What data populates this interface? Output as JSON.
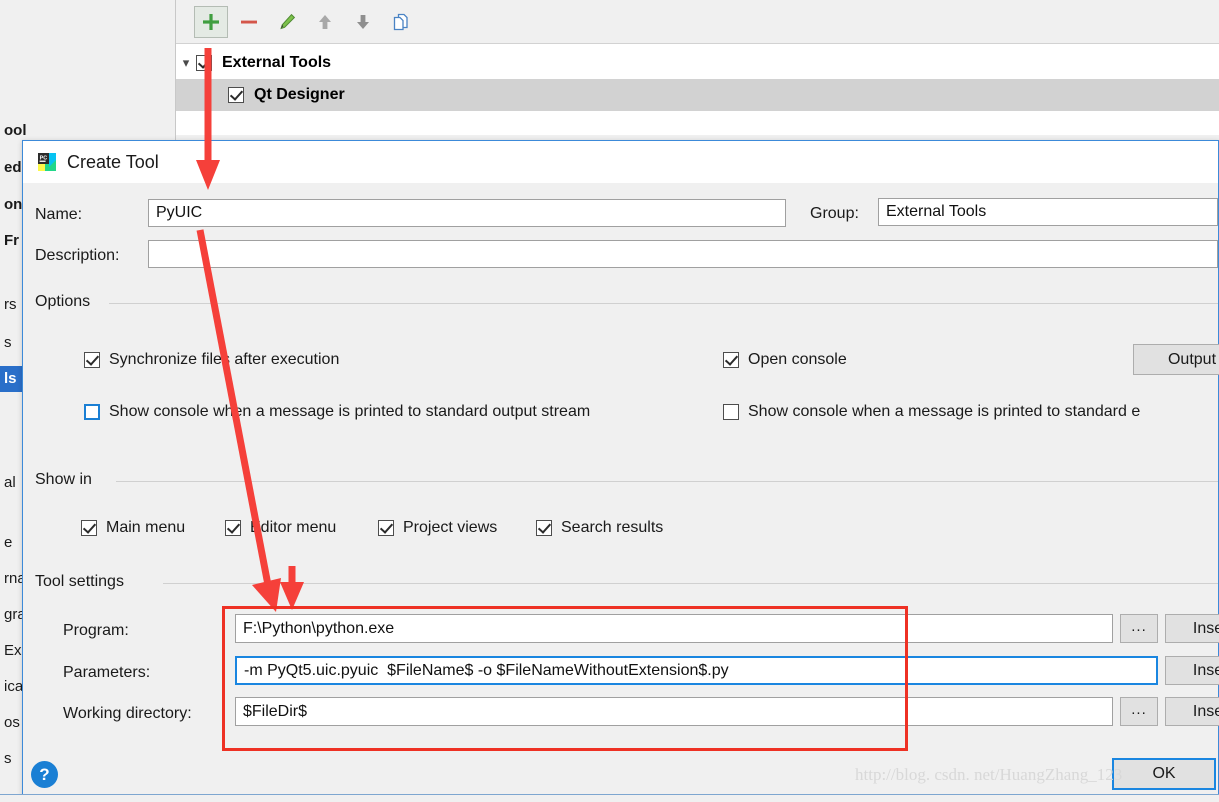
{
  "background_window": {
    "sidebar_items": [
      {
        "label": "ool",
        "bold": true,
        "selected": false
      },
      {
        "label": "ed",
        "bold": true,
        "selected": false
      },
      {
        "label": "on",
        "bold": true,
        "selected": false
      },
      {
        "label": "Fr",
        "bold": true,
        "selected": false
      },
      {
        "label": "rs",
        "bold": false,
        "selected": false
      },
      {
        "label": "s",
        "bold": false,
        "selected": false
      },
      {
        "label": "ls",
        "bold": true,
        "selected": true
      },
      {
        "label": "al",
        "bold": false,
        "selected": false
      },
      {
        "label": "e",
        "bold": false,
        "selected": false
      },
      {
        "label": "rna",
        "bold": false,
        "selected": false
      },
      {
        "label": "gra",
        "bold": false,
        "selected": false
      },
      {
        "label": "Ex",
        "bold": false,
        "selected": false
      },
      {
        "label": "ica",
        "bold": false,
        "selected": false
      },
      {
        "label": "os",
        "bold": false,
        "selected": false
      },
      {
        "label": "s",
        "bold": false,
        "selected": false
      }
    ],
    "toolbar": [
      {
        "name": "add",
        "glyph": "+",
        "color": "#3f9e3f",
        "active": true
      },
      {
        "name": "remove",
        "glyph": "−",
        "color": "#d4564a",
        "active": false
      },
      {
        "name": "edit",
        "glyph": "pencil",
        "color": "#6aa84f",
        "active": false
      },
      {
        "name": "move-up",
        "glyph": "↑",
        "color": "#a8a8a8",
        "active": false
      },
      {
        "name": "move-down",
        "glyph": "↓",
        "color": "#8f8f8f",
        "active": false
      },
      {
        "name": "copy",
        "glyph": "copy",
        "color": "#4a83c4",
        "active": false
      }
    ],
    "copy_icon_tooltip": "Copy",
    "tree": [
      {
        "label": "External Tools",
        "checked": true,
        "selected": false,
        "indent": 0,
        "expanded": true
      },
      {
        "label": "Qt Designer",
        "checked": true,
        "selected": true,
        "indent": 1,
        "expanded": false
      }
    ]
  },
  "dialog": {
    "title": "Create Tool",
    "app_icon": "pycharm-icon",
    "name": {
      "label": "Name:",
      "value": "PyUIC",
      "placeholder": ""
    },
    "group": {
      "label": "Group:",
      "value": "External Tools",
      "placeholder": ""
    },
    "description": {
      "label": "Description:",
      "value": "",
      "placeholder": ""
    },
    "options": {
      "caption": "Options",
      "items": [
        {
          "label": "Synchronize files after execution",
          "checked": true,
          "focused": false
        },
        {
          "label": "Show console when a message is printed to standard output stream",
          "checked": false,
          "focused": true
        },
        {
          "label": "Open console",
          "checked": true,
          "focused": false
        },
        {
          "label": "Show console when a message is printed to standard e",
          "checked": false,
          "focused": false
        }
      ],
      "output_button": "Output"
    },
    "show_in": {
      "caption": "Show in",
      "items": [
        {
          "label": "Main menu",
          "checked": true
        },
        {
          "label": "Editor menu",
          "checked": true
        },
        {
          "label": "Project views",
          "checked": true
        },
        {
          "label": "Search results",
          "checked": true
        }
      ]
    },
    "tool_settings": {
      "caption": "Tool settings",
      "rows": [
        {
          "label": "Program:",
          "value": "F:\\Python\\python.exe",
          "focused": false,
          "browse_button": "...",
          "insert_button": "Inse",
          "has_browse": true
        },
        {
          "label": "Parameters:",
          "value": "-m PyQt5.uic.pyuic  $FileName$ -o $FileNameWithoutExtension$.py",
          "focused": true,
          "browse_button": "",
          "insert_button": "Inse",
          "has_browse": false
        },
        {
          "label": "Working directory:",
          "value": "$FileDir$",
          "focused": false,
          "browse_button": "...",
          "insert_button": "Inse",
          "has_browse": true
        }
      ]
    },
    "help_button": "?",
    "ok_button": "OK"
  },
  "annotations": {
    "highlight_box_color": "#ee3124",
    "arrow_color": "#f5403a",
    "watermark": "http://blog. csdn. net/HuangZhang_123"
  }
}
